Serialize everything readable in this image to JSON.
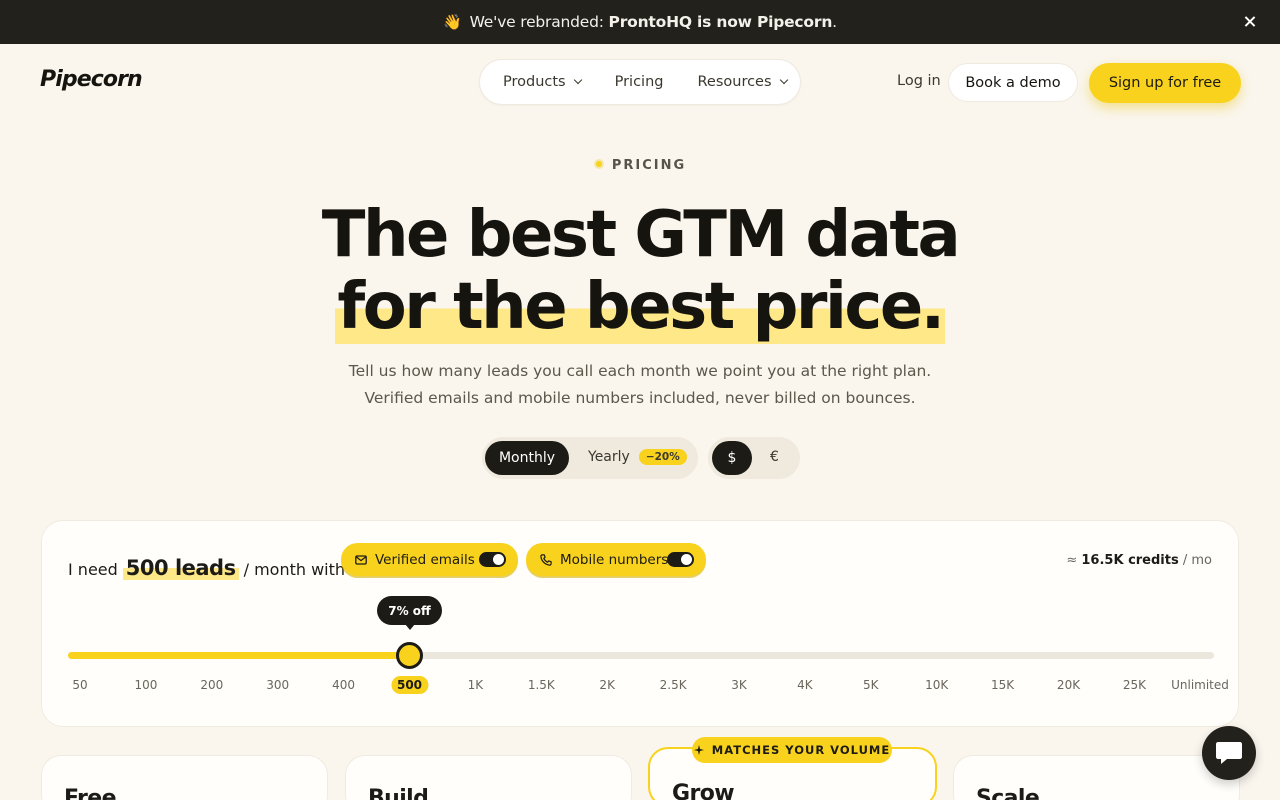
{
  "banner": {
    "wave_emoji": "👋",
    "prefix": "We've rebranded:",
    "highlight": "ProntoHQ is now Pipecorn",
    "suffix": "."
  },
  "brand": {
    "logo": "Pipecorn",
    "accent": "#f8d21c",
    "dark": "#1d1b16"
  },
  "nav": {
    "items": [
      "Products",
      "Pricing",
      "Resources"
    ],
    "login": "Log in",
    "demo": "Book a demo",
    "signup": "Sign up for free"
  },
  "hero": {
    "eyebrow": "PRICING",
    "title_line1": "The best GTM data",
    "title_line2": "for the best price.",
    "subtitle_line1": "Tell us how many leads you call each month we point you at the right plan.",
    "subtitle_line2": "Verified emails and mobile numbers included, never billed on bounces."
  },
  "billing": {
    "monthly": "Monthly",
    "yearly": "Yearly",
    "yearly_discount": "−20%",
    "currency_usd": "$",
    "currency_eur": "€"
  },
  "calculator": {
    "prefix": "I need",
    "amount": "500 leads",
    "suffix": "/ month with",
    "chip_emails": "Verified emails",
    "chip_mobile": "Mobile numbers",
    "emails_enabled": true,
    "mobile_enabled": true,
    "credits_prefix": "≈",
    "credits_value": "16.5K credits",
    "credits_suffix": "/ mo",
    "tooltip": "7% off",
    "selected_index": 6,
    "ticks": [
      "50",
      "100",
      "200",
      "300",
      "400",
      "500",
      "1K",
      "1.5K",
      "2K",
      "2.5K",
      "3K",
      "4K",
      "5K",
      "10K",
      "15K",
      "20K",
      "25K",
      "Unlimited"
    ]
  },
  "plans": {
    "badge": "MATCHES YOUR VOLUME",
    "names": [
      "Free",
      "Build",
      "Grow",
      "Scale"
    ]
  }
}
